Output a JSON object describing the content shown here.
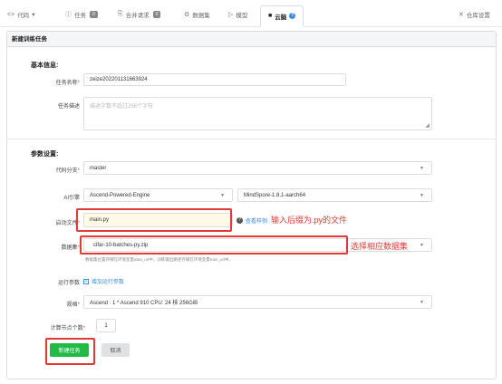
{
  "nav": {
    "items": [
      {
        "icon": "<>",
        "label": "代码",
        "suffix": "▾"
      },
      {
        "icon": "ⓘ",
        "label": "任务",
        "badge": "0"
      },
      {
        "icon": "⎘",
        "label": "合并请求",
        "badge": "0"
      },
      {
        "icon": "⚙",
        "label": "数据集"
      },
      {
        "icon": "▷",
        "label": "模型"
      },
      {
        "icon": "■",
        "label": "云脑"
      }
    ],
    "settings_icon": "✕",
    "settings_label": "仓库设置",
    "help_glyph": "?"
  },
  "page": {
    "header": "新建训练任务"
  },
  "basic": {
    "title": "基本信息:",
    "task_name_label": "任务名称",
    "task_name_value": "zeize202201131663924",
    "task_desc_label": "任务描述",
    "task_desc_placeholder": "描述字数不超过256个字符"
  },
  "params": {
    "title": "参数设置:",
    "branch_label": "代码分支",
    "branch_value": "master",
    "engine_label": "AI引擎",
    "engine_value": "Ascend-Powered-Engine",
    "engine_version": "MindSpore-1.8.1-aarch64",
    "boot_label": "启动文件",
    "boot_value": "main.py",
    "boot_link": "查看样例",
    "dataset_label": "数据集",
    "dataset_value": "cifar-10-batches-py.zip",
    "dataset_hint": "数据集位置存储在环境变量data_url中，训练输出路径存储在环境变量train_url中。",
    "run_params_label": "运行参数",
    "run_params_link": "增加运行参数",
    "spec_label": "规格",
    "spec_value": "Ascend : 1 * Ascend 910 CPU: 24 核 256GiB",
    "nodes_label": "计算节点个数",
    "nodes_value": "1"
  },
  "annotations": {
    "boot_note": "输入后缀为.py的文件",
    "dataset_note": "选择相应数据集"
  },
  "buttons": {
    "submit": "新建任务",
    "cancel": "取消"
  },
  "colors": {
    "primary": "#21ba45",
    "annotation": "#e53935",
    "link": "#3c8ddb"
  }
}
